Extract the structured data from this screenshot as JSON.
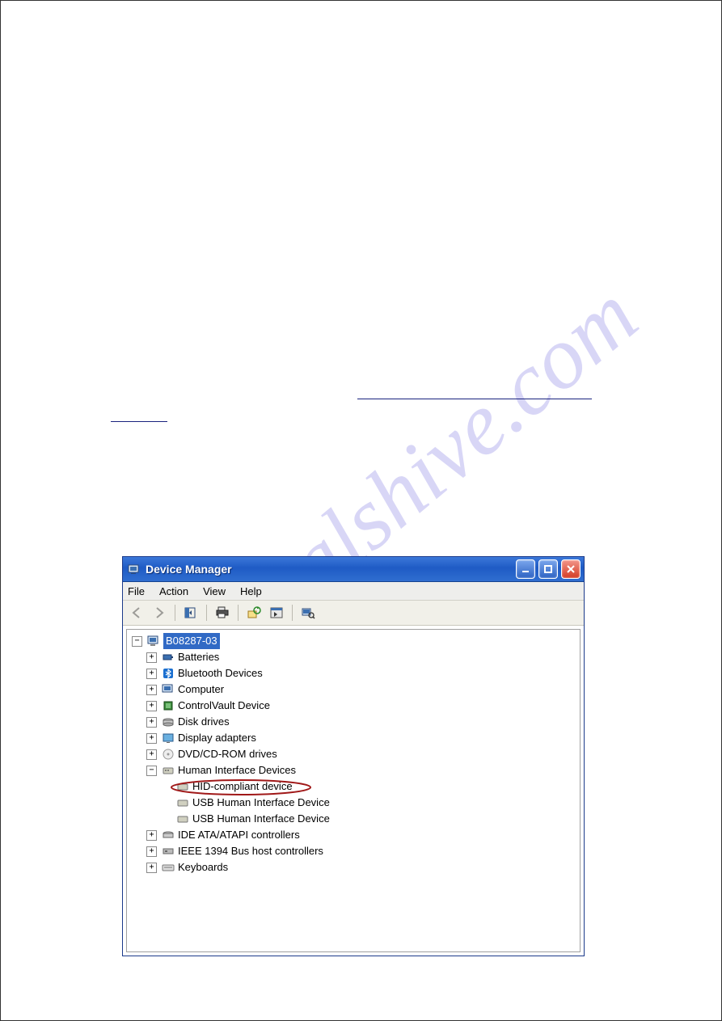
{
  "page": {
    "watermark": "manualshive.com"
  },
  "window": {
    "title": "Device Manager",
    "menu": {
      "file": "File",
      "action": "Action",
      "view": "View",
      "help": "Help"
    }
  },
  "tree": {
    "root": "B08287-03",
    "nodes": {
      "batteries": "Batteries",
      "bluetooth": "Bluetooth Devices",
      "computer": "Computer",
      "controlvault": "ControlVault Device",
      "diskdrives": "Disk drives",
      "display": "Display adapters",
      "dvdcd": "DVD/CD-ROM drives",
      "hid": "Human Interface Devices",
      "hid_compliant": "HID-compliant device",
      "usb_hid_1": "USB Human Interface Device",
      "usb_hid_2": "USB Human Interface Device",
      "ide": "IDE ATA/ATAPI controllers",
      "ieee1394": "IEEE 1394 Bus host controllers",
      "keyboards": "Keyboards"
    }
  }
}
